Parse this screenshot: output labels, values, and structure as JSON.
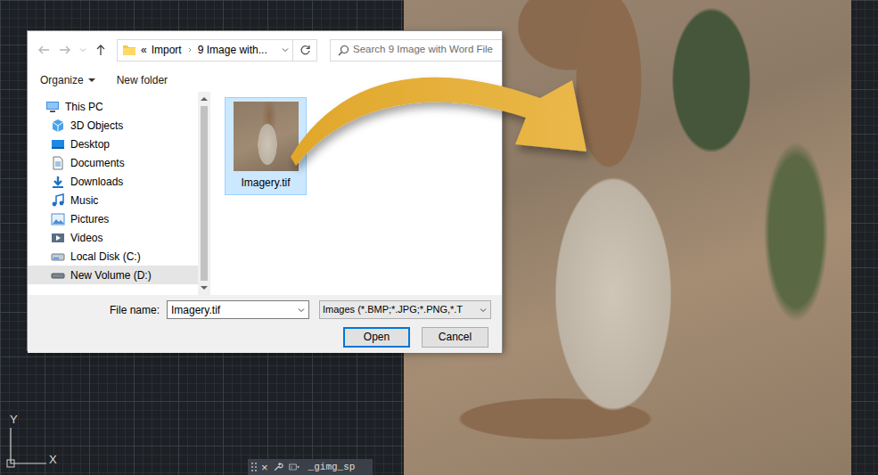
{
  "dialog": {
    "address": {
      "overflow": "«",
      "path": [
        "Import",
        "9 Image with..."
      ]
    },
    "search": {
      "placeholder": "Search 9 Image with Word File"
    },
    "toolbar": [
      {
        "label": "Organize",
        "menu": true
      },
      {
        "label": "New folder",
        "menu": false
      }
    ],
    "sidebar": {
      "items": [
        {
          "label": "This PC",
          "kind": "computer",
          "selected": false
        },
        {
          "label": "3D Objects",
          "kind": "objects",
          "selected": false
        },
        {
          "label": "Desktop",
          "kind": "desktop",
          "selected": false
        },
        {
          "label": "Documents",
          "kind": "documents",
          "selected": false
        },
        {
          "label": "Downloads",
          "kind": "downloads",
          "selected": false
        },
        {
          "label": "Music",
          "kind": "music",
          "selected": false
        },
        {
          "label": "Pictures",
          "kind": "pictures",
          "selected": false
        },
        {
          "label": "Videos",
          "kind": "videos",
          "selected": false
        },
        {
          "label": "Local Disk (C:)",
          "kind": "disk",
          "selected": false
        },
        {
          "label": "New Volume (D:)",
          "kind": "drive",
          "selected": true
        }
      ]
    },
    "files": [
      {
        "name": "Imagery.tif",
        "selected": true
      }
    ],
    "file_name": {
      "label": "File name:",
      "value": "Imagery.tif"
    },
    "file_type": {
      "value": "Images (*.BMP;*.JPG;*.PNG,*.T"
    },
    "buttons": [
      {
        "label": "Open",
        "default": true
      },
      {
        "label": "Cancel",
        "default": false
      }
    ]
  },
  "canvas": {
    "ucs": {
      "y": "Y",
      "x": "X"
    },
    "command_line": {
      "close": "×",
      "text": "_gimg_sp"
    }
  }
}
